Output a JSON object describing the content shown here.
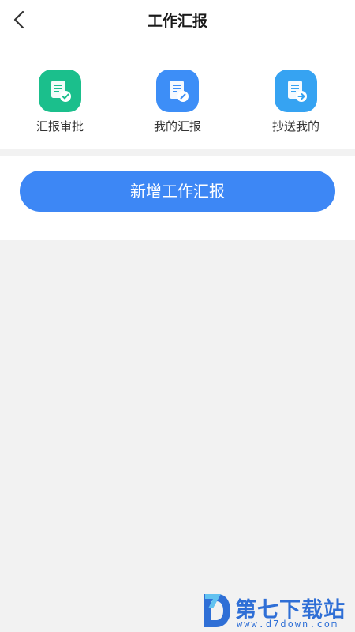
{
  "header": {
    "title": "工作汇报",
    "back_icon": "chevron-left-icon"
  },
  "shortcuts": [
    {
      "label": "汇报审批",
      "icon": "report-approval-icon",
      "color": "#1bbf8c"
    },
    {
      "label": "我的汇报",
      "icon": "my-report-icon",
      "color": "#3d8ef7"
    },
    {
      "label": "抄送我的",
      "icon": "cc-to-me-icon",
      "color": "#36a3f2"
    }
  ],
  "action": {
    "add_label": "新增工作汇报",
    "color": "#3d87f5"
  },
  "watermark": {
    "title": "第七下载站",
    "url": "www.d7down.com",
    "color": "#2f6fd6"
  }
}
